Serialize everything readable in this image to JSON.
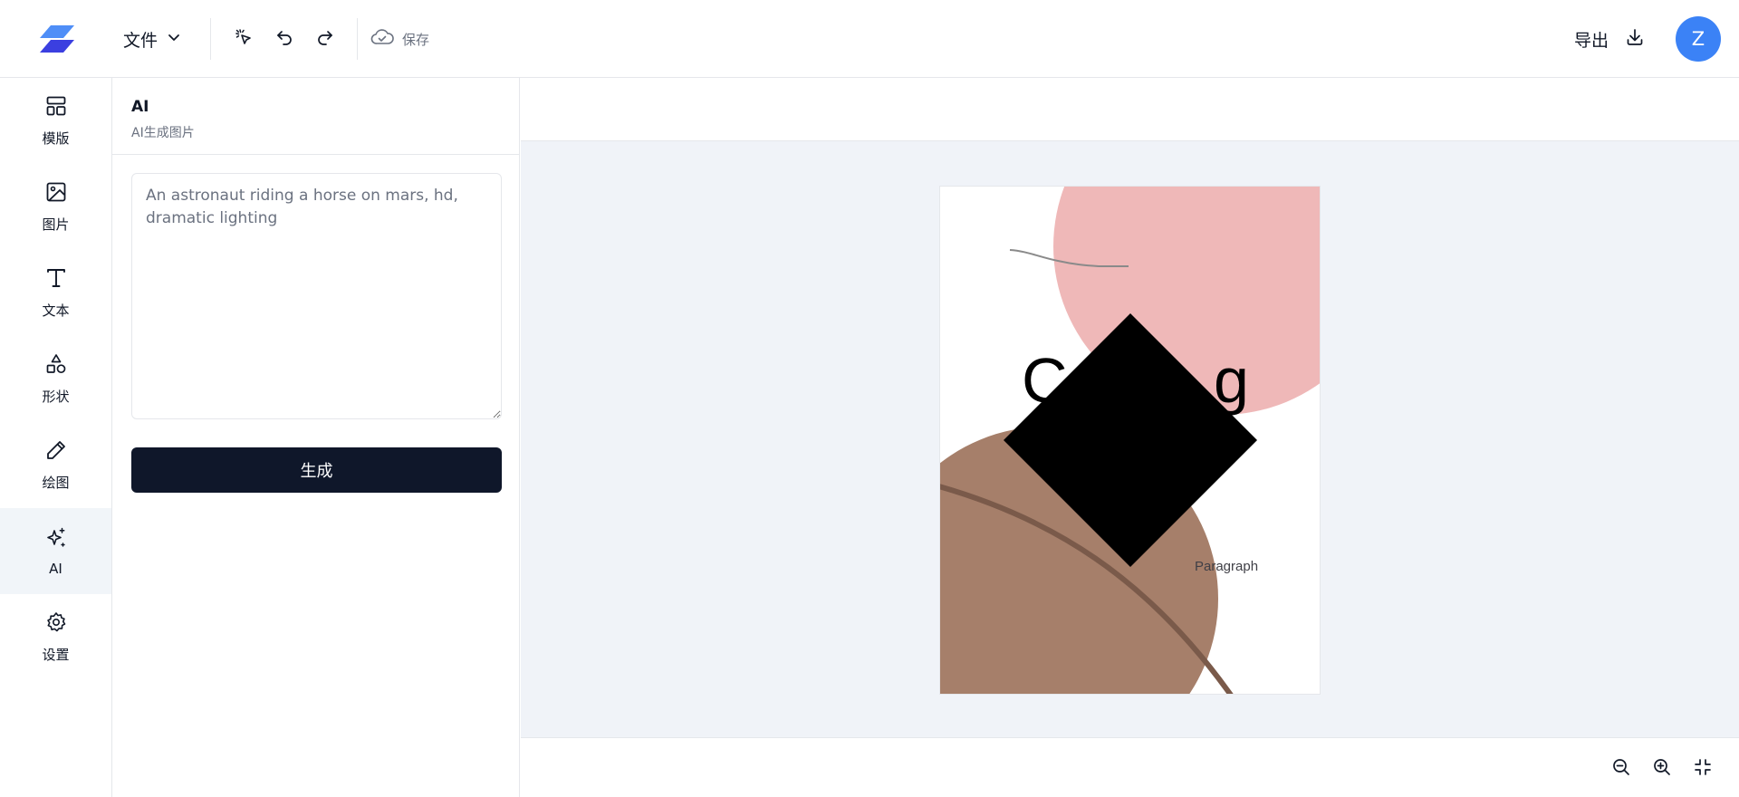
{
  "app": {
    "logo_icon": "stacked-parallelogram-logo",
    "brand_color": "#3b3fe0"
  },
  "toolbar": {
    "file_label": "文件",
    "save_label": "保存",
    "export_label": "导出",
    "user_initial": "Z",
    "avatar_color": "#3b82f6"
  },
  "nav": {
    "items": [
      {
        "label": "模版",
        "icon": "layout-icon"
      },
      {
        "label": "图片",
        "icon": "image-icon"
      },
      {
        "label": "文本",
        "icon": "text-icon"
      },
      {
        "label": "形状",
        "icon": "shapes-icon"
      },
      {
        "label": "绘图",
        "icon": "pencil-icon"
      },
      {
        "label": "AI",
        "icon": "sparkles-icon"
      },
      {
        "label": "设置",
        "icon": "gear-icon"
      }
    ],
    "active": "AI"
  },
  "panel": {
    "title": "AI",
    "subtitle": "AI生成图片",
    "prompt_value": "",
    "prompt_placeholder": "An astronaut riding a horse on mars, hd, dramatic lighting",
    "generate_label": "生成"
  },
  "canvas": {
    "background": "#f0f3f8",
    "artboard": {
      "paragraph_text": "Paragraph",
      "pink_circle_color": "#efb8b8",
      "brown_circle_color": "#a67f6a",
      "diamond_color": "#000000"
    }
  }
}
